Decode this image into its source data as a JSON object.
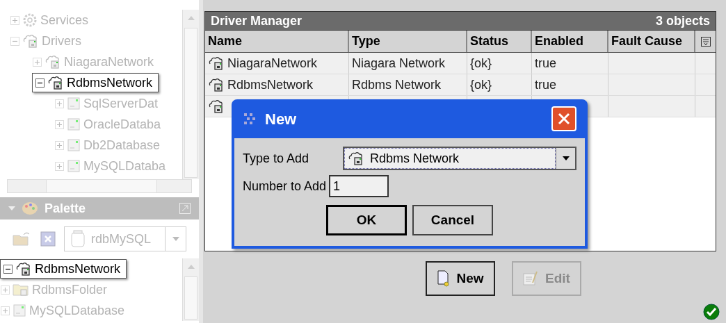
{
  "nav_tree": {
    "items": [
      {
        "label": "Services",
        "kind": "gear",
        "expanded": false,
        "highlighted": false
      },
      {
        "label": "Drivers",
        "kind": "network",
        "expanded": true,
        "highlighted": false,
        "children": [
          {
            "label": "NiagaraNetwork",
            "kind": "network",
            "expanded": false,
            "highlighted": false
          },
          {
            "label": "RdbmsNetwork",
            "kind": "network",
            "expanded": true,
            "highlighted": true,
            "children": [
              {
                "label": "SqlServerDat",
                "kind": "database",
                "expanded": false,
                "highlighted": false
              },
              {
                "label": "OracleDataba",
                "kind": "database",
                "expanded": false,
                "highlighted": false
              },
              {
                "label": "Db2Database",
                "kind": "database",
                "expanded": false,
                "highlighted": false
              },
              {
                "label": "MySQLDataba",
                "kind": "database",
                "expanded": false,
                "highlighted": false
              }
            ]
          }
        ]
      }
    ]
  },
  "palette": {
    "title": "Palette",
    "module": "rdbMySQL",
    "items": [
      {
        "label": "RdbmsNetwork",
        "kind": "network",
        "expanded": true,
        "highlighted": true
      },
      {
        "label": "RdbmsFolder",
        "kind": "folder",
        "expanded": false,
        "highlighted": false
      },
      {
        "label": "MySQLDatabase",
        "kind": "database",
        "expanded": false,
        "highlighted": false
      }
    ]
  },
  "manager": {
    "title": "Driver Manager",
    "count": "3 objects",
    "columns": [
      "Name",
      "Type",
      "Status",
      "Enabled",
      "Fault Cause"
    ],
    "rows": [
      {
        "name": "NiagaraNetwork",
        "type": "Niagara Network",
        "status": "{ok}",
        "enabled": "true"
      },
      {
        "name": "RdbmsNetwork",
        "type": "Rdbms Network",
        "status": "{ok}",
        "enabled": "true"
      },
      {}
    ],
    "buttons": [
      {
        "label": "New",
        "kind": "new",
        "disabled": false
      },
      {
        "label": "Edit",
        "kind": "edit",
        "disabled": true
      }
    ]
  },
  "dialog": {
    "title": "New",
    "fields": [
      {
        "kind": "select",
        "label": "Type to Add",
        "value": "Rdbms Network"
      },
      {
        "kind": "input",
        "label": "Number to Add",
        "value": "1"
      }
    ],
    "buttons": [
      {
        "label": "OK",
        "default": true
      },
      {
        "label": "Cancel",
        "default": false
      }
    ]
  }
}
